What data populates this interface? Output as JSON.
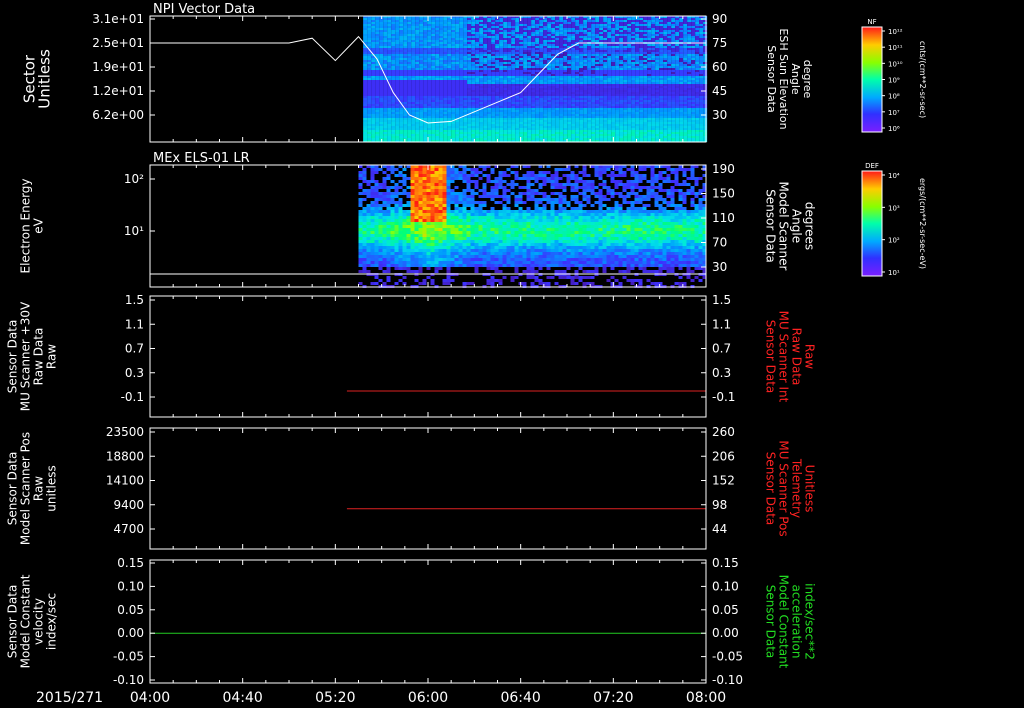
{
  "time_axis": {
    "date_label": "2015/271",
    "ticks": [
      "04:00",
      "04:40",
      "05:20",
      "06:00",
      "06:40",
      "07:20",
      "08:00"
    ]
  },
  "chart_data": [
    {
      "type": "heatmap",
      "title": "NPI Vector Data",
      "ylabel": "Sector\nUnitless",
      "yticks": [
        "3.1e+01",
        "2.5e+01",
        "1.9e+01",
        "1.2e+01",
        "6.2e+00"
      ],
      "y2label": "Sensor Data\nESH Sun Elevation\nAngle\ndegree",
      "y2ticks": [
        "90",
        "75",
        "60",
        "45",
        "30"
      ],
      "y2lim": [
        15,
        90
      ],
      "data_start_time": "05:32",
      "overlay_line": {
        "label": "ESH Sun Elevation Angle",
        "color": "#ffffff",
        "x": [
          "04:00",
          "05:00",
          "05:10",
          "05:20",
          "05:30",
          "05:38",
          "05:45",
          "05:52",
          "06:00",
          "06:10",
          "06:20",
          "06:30",
          "06:40",
          "06:48",
          "06:56",
          "07:05",
          "07:20",
          "07:40",
          "08:00"
        ],
        "y": [
          75,
          75,
          78,
          64,
          79,
          65,
          44,
          30,
          25,
          26,
          32,
          38,
          44,
          56,
          68,
          75,
          75,
          75,
          75
        ]
      },
      "colorbar": {
        "label": "NF",
        "units": "cnts/(cm**2-sr-sec)",
        "ticks": [
          "10¹²",
          "10¹¹",
          "10¹⁰",
          "10⁹",
          "10⁸",
          "10⁷",
          "10⁶"
        ]
      }
    },
    {
      "type": "heatmap",
      "title": "MEx ELS-01 LR",
      "ylabel": "Electron Energy\neV",
      "yticks": [
        "10²",
        "10¹"
      ],
      "yscale": "log",
      "y2label": "Sensor Data\nModel Scanner\nAngle\ndegrees",
      "y2ticks": [
        "190",
        "150",
        "110",
        "70",
        "30"
      ],
      "data_start_time": "05:30",
      "overlay_line": {
        "label": "Model Scanner Angle",
        "color": "#ffffff",
        "x": [
          "04:00",
          "08:00"
        ],
        "y": [
          14,
          14
        ]
      },
      "colorbar": {
        "label": "DEF",
        "units": "ergs/(cm**2-sr-sec-eV)",
        "ticks": [
          "10⁴",
          "10³",
          "10²",
          "10¹"
        ]
      }
    },
    {
      "type": "line",
      "ylabel": "Sensor Data\nMU Scanner +30V\nRaw Data\nRaw",
      "yticks": [
        "1.5",
        "1.1",
        "0.7",
        "0.3",
        "-0.1"
      ],
      "ylim": [
        -0.5,
        1.5
      ],
      "y2label": "Sensor Data\nMU Scanner Int\nRaw Data\nRaw",
      "y2ticks": [
        "1.5",
        "1.1",
        "0.7",
        "0.3",
        "-0.1"
      ],
      "series": [
        {
          "color": "#dd2222",
          "x": [
            "05:25",
            "08:00"
          ],
          "y": [
            -0.05,
            -0.05
          ]
        }
      ]
    },
    {
      "type": "line",
      "ylabel": "Sensor Data\nModel Scanner Pos\nRaw\nunitless",
      "yticks": [
        "23500",
        "18800",
        "14100",
        "9400",
        "4700"
      ],
      "ylim": [
        0,
        23500
      ],
      "y2label": "Sensor Data\nMU Scanner Pos\nTelemetry\nUnitless",
      "y2ticks": [
        "260",
        "206",
        "152",
        "98",
        "44"
      ],
      "y2lim": [
        0,
        260
      ],
      "series": [
        {
          "color": "#dd2222",
          "x": [
            "05:25",
            "08:00"
          ],
          "y2": [
            90,
            90
          ]
        }
      ]
    },
    {
      "type": "line",
      "ylabel": "Sensor Data\nModel Constant\nvelocity\nindex/sec",
      "yticks": [
        "0.15",
        "0.10",
        "0.05",
        "0.00",
        "-0.05",
        "-0.10"
      ],
      "ylim": [
        -0.1,
        0.15
      ],
      "y2label": "Sensor Data\nModel Constant\nacceleration\nindex/sec**2",
      "y2ticks": [
        "0.15",
        "0.10",
        "0.05",
        "0.00",
        "-0.05",
        "-0.10"
      ],
      "series": [
        {
          "color": "#22cc22",
          "x": [
            "04:00",
            "08:00"
          ],
          "y": [
            0,
            0
          ]
        }
      ]
    }
  ],
  "colors": {
    "red_label": "#ff2222",
    "green_label": "#22dd22"
  }
}
